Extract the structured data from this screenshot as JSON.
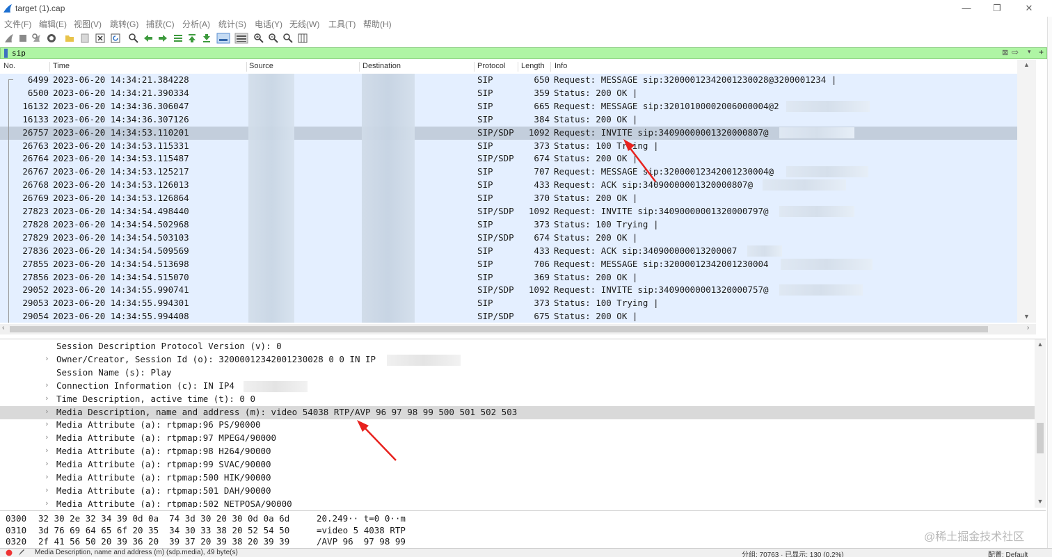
{
  "window": {
    "title": "target (1).cap",
    "minimize": "—",
    "restore": "❐",
    "close": "✕"
  },
  "menu": [
    "文件(F)",
    "编辑(E)",
    "视图(V)",
    "跳转(G)",
    "捕获(C)",
    "分析(A)",
    "统计(S)",
    "电话(Y)",
    "无线(W)",
    "工具(T)",
    "帮助(H)"
  ],
  "filter": {
    "value": "sip"
  },
  "columns": [
    "No.",
    "Time",
    "Source",
    "Destination",
    "Protocol",
    "Length",
    "Info"
  ],
  "packets": [
    {
      "no": "6499",
      "time": "2023-06-20 14:34:21.384228",
      "proto": "SIP",
      "len": "650",
      "info": "Request: MESSAGE sip:32000012342001230028@3200001234 |"
    },
    {
      "no": "6500",
      "time": "2023-06-20 14:34:21.390334",
      "proto": "SIP",
      "len": "359",
      "info": "Status: 200 OK |"
    },
    {
      "no": "16132",
      "time": "2023-06-20 14:34:36.306047",
      "proto": "SIP",
      "len": "665",
      "info": "Request: MESSAGE sip:32010100002006000004@2"
    },
    {
      "no": "16133",
      "time": "2023-06-20 14:34:36.307126",
      "proto": "SIP",
      "len": "384",
      "info": "Status: 200 OK |"
    },
    {
      "no": "26757",
      "time": "2023-06-20 14:34:53.110201",
      "proto": "SIP/SDP",
      "len": "1092",
      "info": "Request: INVITE sip:34090000001320000807@"
    },
    {
      "no": "26763",
      "time": "2023-06-20 14:34:53.115331",
      "proto": "SIP",
      "len": "373",
      "info": "Status: 100 Trying |"
    },
    {
      "no": "26764",
      "time": "2023-06-20 14:34:53.115487",
      "proto": "SIP/SDP",
      "len": "674",
      "info": "Status: 200 OK |"
    },
    {
      "no": "26767",
      "time": "2023-06-20 14:34:53.125217",
      "proto": "SIP",
      "len": "707",
      "info": "Request: MESSAGE sip:32000012342001230004@"
    },
    {
      "no": "26768",
      "time": "2023-06-20 14:34:53.126013",
      "proto": "SIP",
      "len": "433",
      "info": "Request: ACK sip:34090000001320000807@"
    },
    {
      "no": "26769",
      "time": "2023-06-20 14:34:53.126864",
      "proto": "SIP",
      "len": "370",
      "info": "Status: 200 OK |"
    },
    {
      "no": "27823",
      "time": "2023-06-20 14:34:54.498440",
      "proto": "SIP/SDP",
      "len": "1092",
      "info": "Request: INVITE sip:34090000001320000797@"
    },
    {
      "no": "27828",
      "time": "2023-06-20 14:34:54.502968",
      "proto": "SIP",
      "len": "373",
      "info": "Status: 100 Trying |"
    },
    {
      "no": "27829",
      "time": "2023-06-20 14:34:54.503103",
      "proto": "SIP/SDP",
      "len": "674",
      "info": "Status: 200 OK |"
    },
    {
      "no": "27836",
      "time": "2023-06-20 14:34:54.509569",
      "proto": "SIP",
      "len": "433",
      "info": "Request: ACK sip:340900000013200007"
    },
    {
      "no": "27855",
      "time": "2023-06-20 14:34:54.513698",
      "proto": "SIP",
      "len": "706",
      "info": "Request: MESSAGE sip:32000012342001230004"
    },
    {
      "no": "27856",
      "time": "2023-06-20 14:34:54.515070",
      "proto": "SIP",
      "len": "369",
      "info": "Status: 200 OK |"
    },
    {
      "no": "29052",
      "time": "2023-06-20 14:34:55.990741",
      "proto": "SIP/SDP",
      "len": "1092",
      "info": "Request: INVITE sip:34090000001320000757@"
    },
    {
      "no": "29053",
      "time": "2023-06-20 14:34:55.994301",
      "proto": "SIP",
      "len": "373",
      "info": "Status: 100 Trying |"
    },
    {
      "no": "29054",
      "time": "2023-06-20 14:34:55.994408",
      "proto": "SIP/SDP",
      "len": "675",
      "info": "Status: 200 OK |"
    }
  ],
  "details": [
    {
      "text": "Session Description Protocol Version (v): 0",
      "expandable": false
    },
    {
      "text": "Owner/Creator, Session Id (o): 32000012342001230028 0 0 IN IP",
      "expandable": true
    },
    {
      "text": "Session Name (s): Play",
      "expandable": false
    },
    {
      "text": "Connection Information (c): IN IP4",
      "expandable": true
    },
    {
      "text": "Time Description, active time (t): 0 0",
      "expandable": true
    },
    {
      "text": "Media Description, name and address (m): video 54038 RTP/AVP 96 97 98 99 500 501 502 503",
      "expandable": true
    },
    {
      "text": "Media Attribute (a): rtpmap:96 PS/90000",
      "expandable": true
    },
    {
      "text": "Media Attribute (a): rtpmap:97 MPEG4/90000",
      "expandable": true
    },
    {
      "text": "Media Attribute (a): rtpmap:98 H264/90000",
      "expandable": true
    },
    {
      "text": "Media Attribute (a): rtpmap:99 SVAC/90000",
      "expandable": true
    },
    {
      "text": "Media Attribute (a): rtpmap:500 HIK/90000",
      "expandable": true
    },
    {
      "text": "Media Attribute (a): rtpmap:501 DAH/90000",
      "expandable": true
    },
    {
      "text": "Media Attribute (a): rtpmap:502 NETPOSA/90000",
      "expandable": true
    }
  ],
  "bytes": [
    {
      "offset": "0300",
      "hex": "32 30 2e 32 34 39 0d 0a  74 3d 30 20 30 0d 0a 6d",
      "ascii": "20.249·· t=0 0··m"
    },
    {
      "offset": "0310",
      "hex": "3d 76 69 64 65 6f 20 35  34 30 33 38 20 52 54 50",
      "ascii": "=video 5 4038 RTP"
    },
    {
      "offset": "0320",
      "hex": "2f 41 56 50 20 39 36 20  39 37 20 39 38 20 39 39",
      "ascii": "/AVP 96  97 98 99"
    }
  ],
  "status": {
    "field": "Media Description, name and address (m) (sdp.media), 49 byte(s)",
    "packets": "分组: 70763 · 已显示: 130 (0.2%)",
    "profile": "配置: Default"
  },
  "watermark": "@稀土掘金技术社区",
  "colors": {
    "row_bg": "#e4efff",
    "row_selected": "#c3cedc",
    "filter_bg": "#aff5a4",
    "arrow": "#e8221e"
  }
}
